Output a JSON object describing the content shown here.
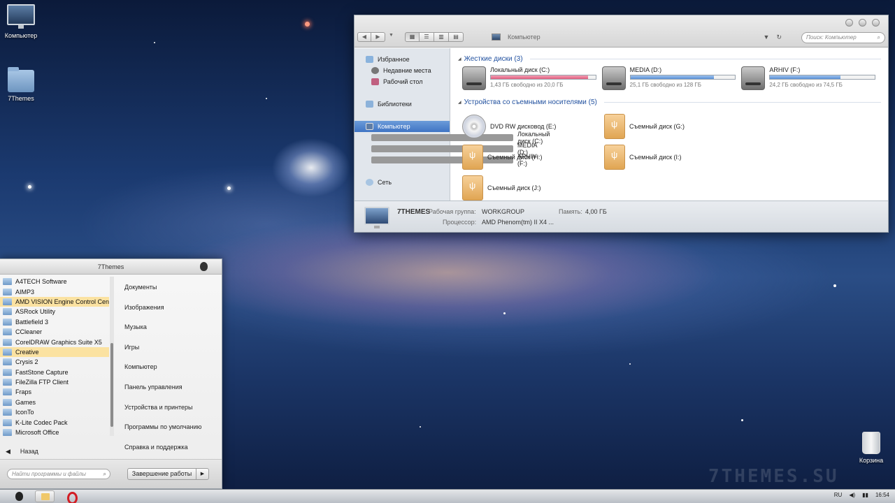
{
  "desktop": {
    "icons": [
      {
        "label": "Компьютер"
      },
      {
        "label": "7Themes"
      },
      {
        "label": "Корзина"
      }
    ],
    "watermark": "7THEMES.SU"
  },
  "explorer": {
    "address": "Компьютер",
    "search_placeholder": "Поиск: Компьютер",
    "sidebar": {
      "favorites": "Избранное",
      "recent": "Недавние места",
      "desktop": "Рабочий стол",
      "libraries": "Библиотеки",
      "computer": "Компьютер",
      "drive_c": "Локальный диск (C:)",
      "drive_d": "MEDIA (D:)",
      "drive_f": "ARHIV (F:)",
      "network": "Сеть"
    },
    "hard_disks_header": "Жесткие диски (3)",
    "hard_disks": [
      {
        "name": "Локальный диск (C:)",
        "free_text": "1,43 ГБ свободно из 20,0 ГБ",
        "used_fraction": 0.93
      },
      {
        "name": "MEDIA (D:)",
        "free_text": "25,1 ГБ свободно из 128 ГБ",
        "used_fraction": 0.8
      },
      {
        "name": "ARHIV (F:)",
        "free_text": "24,2 ГБ свободно из 74,5 ГБ",
        "used_fraction": 0.67
      }
    ],
    "removable_header": "Устройства со съемными носителями (5)",
    "removables": [
      {
        "name": "DVD RW дисковод (E:)"
      },
      {
        "name": "Съемный диск (G:)"
      },
      {
        "name": "Съемный диск (H:)"
      },
      {
        "name": "Съемный диск (I:)"
      },
      {
        "name": "Съемный диск (J:)"
      }
    ],
    "status": {
      "computer_name": "7THEMES",
      "workgroup_label": "Рабочая группа:",
      "workgroup_value": "WORKGROUP",
      "memory_label": "Память:",
      "memory_value": "4,00 ГБ",
      "cpu_label": "Процессор:",
      "cpu_value": "AMD Phenom(tm) II X4 ..."
    }
  },
  "start_menu": {
    "title": "7Themes",
    "programs": [
      "A4TECH Software",
      "AIMP3",
      "AMD VISION Engine Control Cen",
      "ASRock Utility",
      "Battlefield 3",
      "CCleaner",
      "CorelDRAW Graphics Suite X5",
      "Creative",
      "Crysis 2",
      "FastStone Capture",
      "FileZilla FTP Client",
      "Fraps",
      "Games",
      "IconTo",
      "K-Lite Codec Pack",
      "Microsoft Office"
    ],
    "right_items": [
      "Документы",
      "Изображения",
      "Музыка",
      "Игры",
      "Компьютер",
      "Панель управления",
      "Устройства и принтеры",
      "Программы по умолчанию",
      "Справка и поддержка"
    ],
    "back_label": "Назад",
    "search_placeholder": "Найти программы и файлы",
    "shutdown_label": "Завершение работы"
  },
  "taskbar": {
    "language": "RU",
    "time": "16:54"
  }
}
